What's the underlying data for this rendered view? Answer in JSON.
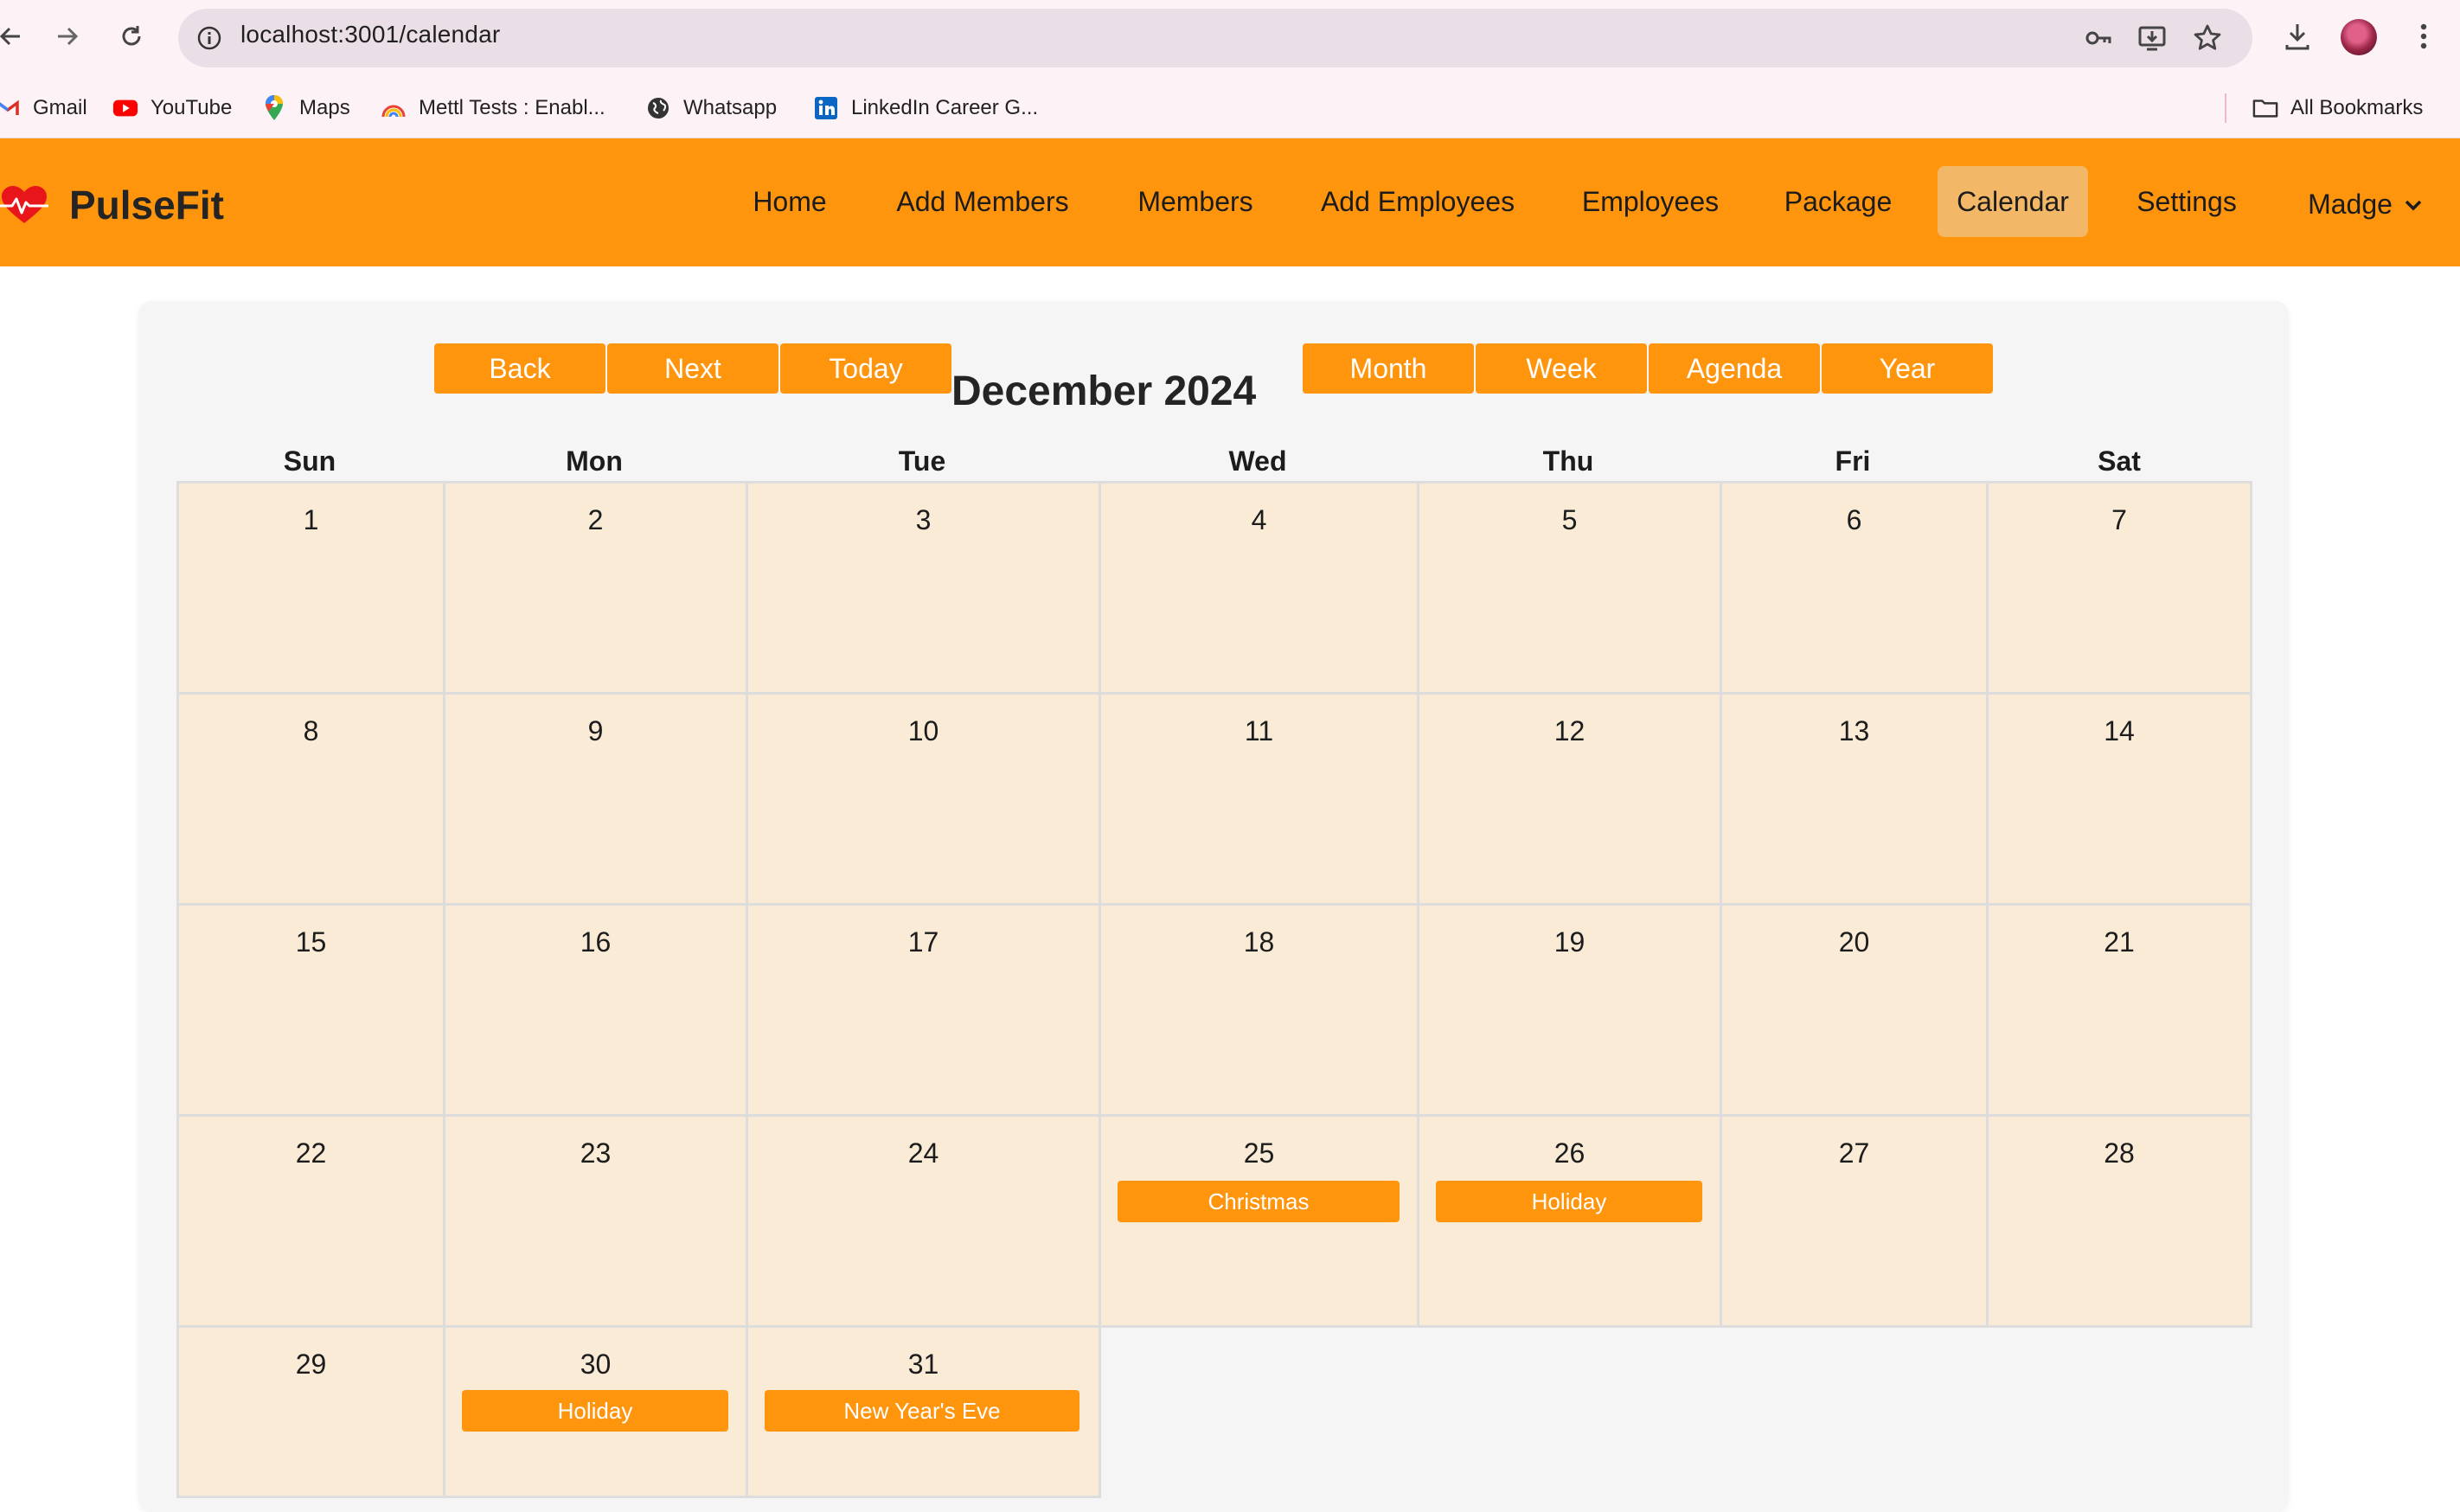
{
  "browser": {
    "url": "localhost:3001/calendar",
    "bookmarks": [
      {
        "label": "Gmail",
        "icon": "gmail-icon"
      },
      {
        "label": "YouTube",
        "icon": "youtube-icon"
      },
      {
        "label": "Maps",
        "icon": "maps-icon"
      },
      {
        "label": "Mettl Tests : Enabl...",
        "icon": "mettl-icon"
      },
      {
        "label": "Whatsapp",
        "icon": "globe-icon"
      },
      {
        "label": "LinkedIn Career G...",
        "icon": "linkedin-icon"
      }
    ],
    "all_bookmarks_label": "All Bookmarks"
  },
  "app": {
    "brand": "PulseFit",
    "nav": [
      {
        "label": "Home"
      },
      {
        "label": "Add Members"
      },
      {
        "label": "Members"
      },
      {
        "label": "Add Employees"
      },
      {
        "label": "Employees"
      },
      {
        "label": "Package"
      },
      {
        "label": "Calendar",
        "active": true
      },
      {
        "label": "Settings"
      },
      {
        "label": "Madge",
        "dropdown": true
      }
    ],
    "colors": {
      "accent": "#ff940d",
      "cell_bg": "#faebd7",
      "active_nav": "#f2b868"
    }
  },
  "calendar": {
    "title": "December 2024",
    "nav_buttons": [
      "Back",
      "Next",
      "Today"
    ],
    "view_buttons": [
      "Month",
      "Week",
      "Agenda",
      "Year"
    ],
    "weekdays": [
      "Sun",
      "Mon",
      "Tue",
      "Wed",
      "Thu",
      "Fri",
      "Sat"
    ],
    "weeks": [
      [
        {
          "day": "1"
        },
        {
          "day": "2"
        },
        {
          "day": "3"
        },
        {
          "day": "4"
        },
        {
          "day": "5"
        },
        {
          "day": "6"
        },
        {
          "day": "7"
        }
      ],
      [
        {
          "day": "8"
        },
        {
          "day": "9"
        },
        {
          "day": "10"
        },
        {
          "day": "11"
        },
        {
          "day": "12"
        },
        {
          "day": "13"
        },
        {
          "day": "14"
        }
      ],
      [
        {
          "day": "15"
        },
        {
          "day": "16"
        },
        {
          "day": "17"
        },
        {
          "day": "18"
        },
        {
          "day": "19"
        },
        {
          "day": "20"
        },
        {
          "day": "21"
        }
      ],
      [
        {
          "day": "22"
        },
        {
          "day": "23"
        },
        {
          "day": "24"
        },
        {
          "day": "25",
          "event": "Christmas"
        },
        {
          "day": "26",
          "event": "Holiday"
        },
        {
          "day": "27"
        },
        {
          "day": "28"
        }
      ],
      [
        {
          "day": "29"
        },
        {
          "day": "30",
          "event": "Holiday"
        },
        {
          "day": "31",
          "event": "New Year's Eve"
        }
      ]
    ]
  }
}
